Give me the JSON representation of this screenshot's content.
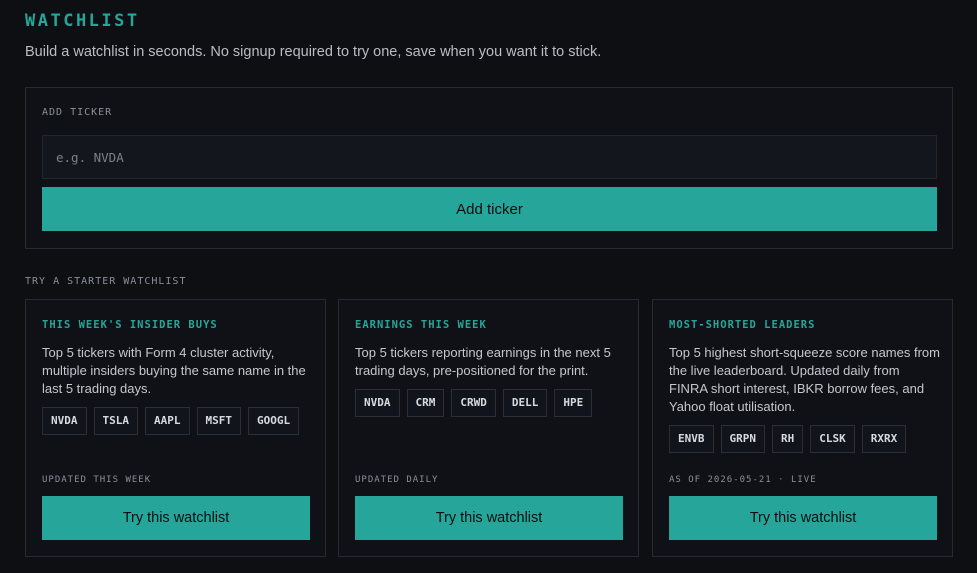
{
  "header": {
    "title": "WATCHLIST",
    "subtitle": "Build a watchlist in seconds. No signup required to try one, save when you want it to stick."
  },
  "add_ticker": {
    "label": "ADD TICKER",
    "placeholder": "e.g. NVDA",
    "button_label": "Add ticker"
  },
  "starter": {
    "label": "TRY A STARTER WATCHLIST",
    "cards": [
      {
        "title": "THIS WEEK'S INSIDER BUYS",
        "description": "Top 5 tickers with Form 4 cluster activity, multiple insiders buying the same name in the last 5 trading days.",
        "tickers": [
          "NVDA",
          "TSLA",
          "AAPL",
          "MSFT",
          "GOOGL"
        ],
        "footer": "UPDATED THIS WEEK",
        "button_label": "Try this watchlist"
      },
      {
        "title": "EARNINGS THIS WEEK",
        "description": "Top 5 tickers reporting earnings in the next 5 trading days, pre-positioned for the print.",
        "tickers": [
          "NVDA",
          "CRM",
          "CRWD",
          "DELL",
          "HPE"
        ],
        "footer": "UPDATED DAILY",
        "button_label": "Try this watchlist"
      },
      {
        "title": "MOST-SHORTED LEADERS",
        "description": "Top 5 highest short-squeeze score names from the live leaderboard. Updated daily from FINRA short interest, IBKR borrow fees, and Yahoo float utilisation.",
        "tickers": [
          "ENVB",
          "GRPN",
          "RH",
          "CLSK",
          "RXRX"
        ],
        "footer": "AS OF 2026-05-21 · LIVE",
        "button_label": "Try this watchlist"
      }
    ]
  },
  "colors": {
    "accent": "#26a69a",
    "background": "#0d0f13",
    "panel": "#0f1116",
    "border": "#262a31"
  }
}
